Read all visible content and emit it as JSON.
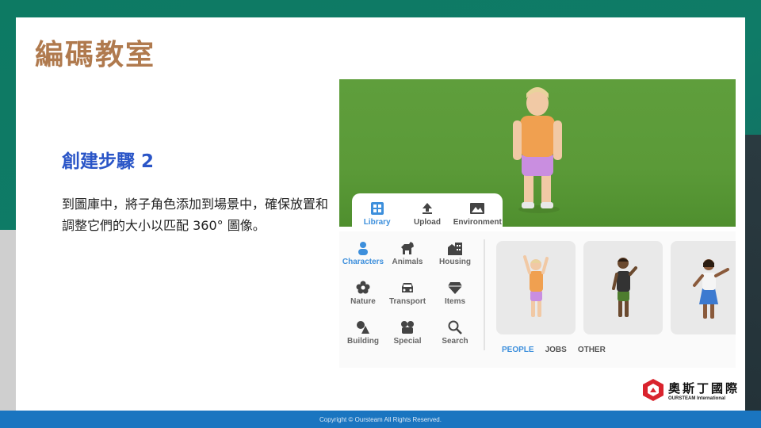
{
  "slide": {
    "title": "編碼教室",
    "step_title": "創建步驟 2",
    "body": "到圖庫中，將子角色添加到場景中，確保放置和調整它們的大小以匹配 360° 圖像。"
  },
  "screenshot": {
    "tabs": [
      {
        "label": "Library",
        "icon": "library-icon",
        "active": true
      },
      {
        "label": "Upload",
        "icon": "upload-icon",
        "active": false
      },
      {
        "label": "Environment",
        "icon": "environment-icon",
        "active": false
      }
    ],
    "categories": [
      {
        "label": "Characters",
        "icon": "person-icon",
        "active": true
      },
      {
        "label": "Animals",
        "icon": "dog-icon",
        "active": false
      },
      {
        "label": "Housing",
        "icon": "building-icon",
        "active": false
      },
      {
        "label": "Nature",
        "icon": "flower-icon",
        "active": false
      },
      {
        "label": "Transport",
        "icon": "car-icon",
        "active": false
      },
      {
        "label": "Items",
        "icon": "diamond-icon",
        "active": false
      },
      {
        "label": "Building",
        "icon": "shapes-icon",
        "active": false
      },
      {
        "label": "Special",
        "icon": "camera-icon",
        "active": false
      },
      {
        "label": "Search",
        "icon": "search-icon",
        "active": false
      }
    ],
    "filters": [
      {
        "label": "PEOPLE",
        "active": true
      },
      {
        "label": "JOBS",
        "active": false
      },
      {
        "label": "OTHER",
        "active": false
      }
    ],
    "accent": "#3d8fdc",
    "scene_color": "#5b9a38"
  },
  "logo": {
    "name_cn": "奧斯丁國際",
    "name_en": "OURSTEAM International"
  },
  "footer": {
    "copyright": "Copyright © Oursteam All Rights Reserved."
  }
}
